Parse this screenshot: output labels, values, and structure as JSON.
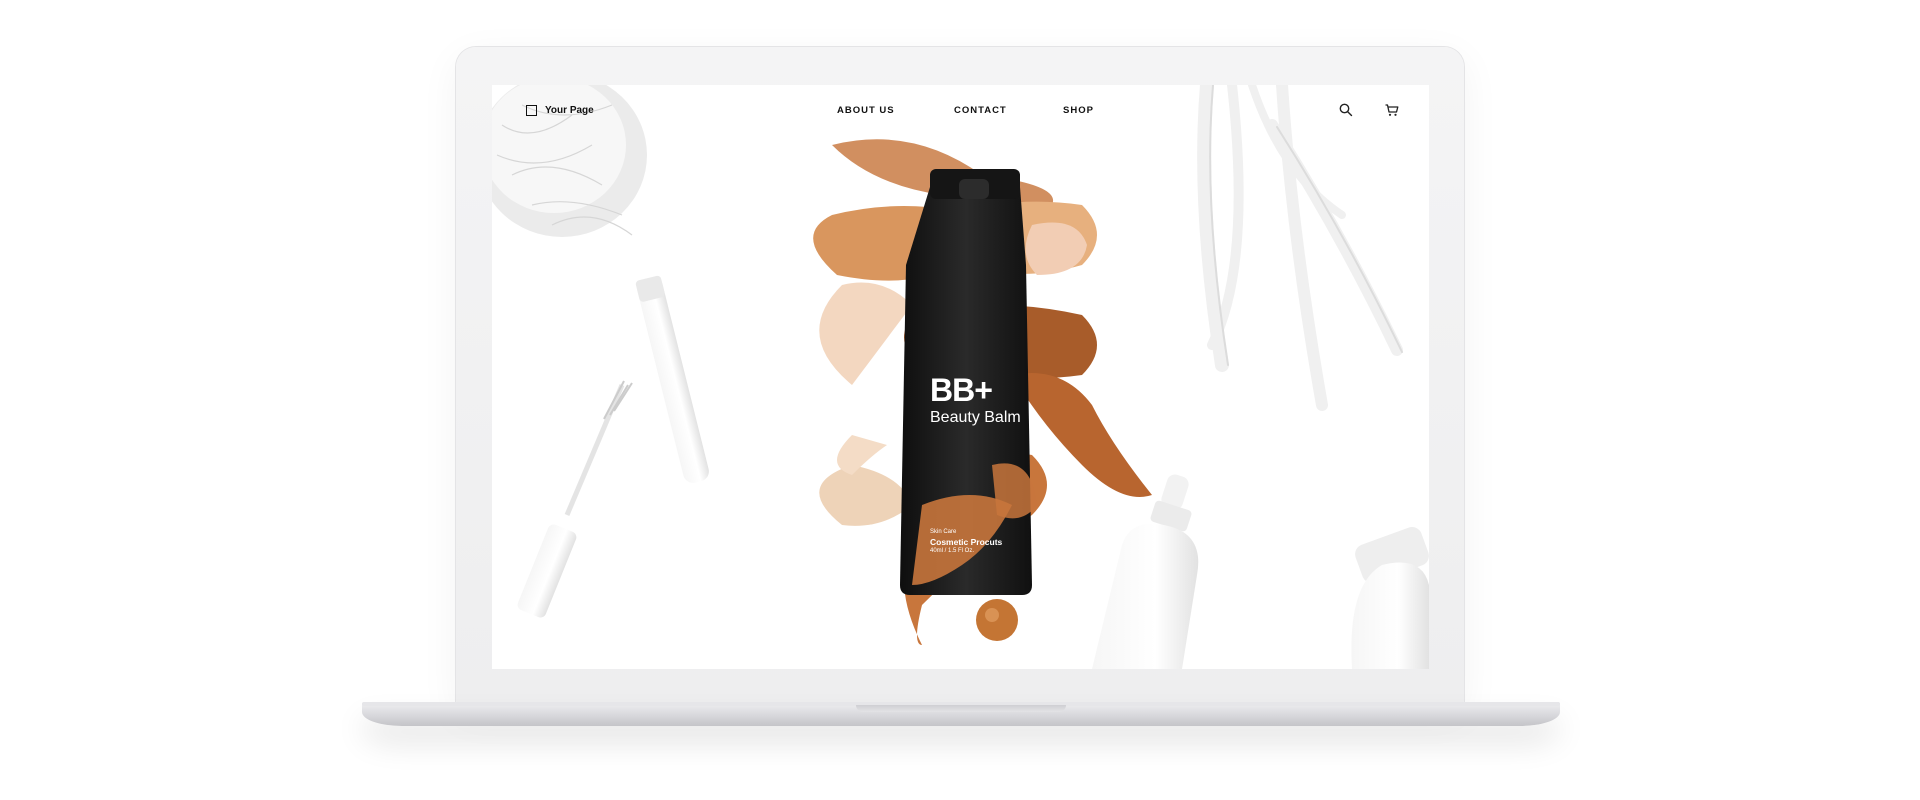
{
  "header": {
    "logo_text": "Your Page",
    "nav": [
      {
        "label": "ABOUT US"
      },
      {
        "label": "CONTACT"
      },
      {
        "label": "SHOP"
      }
    ],
    "icons": [
      "search-icon",
      "cart-icon"
    ]
  },
  "product": {
    "brand_mark": "BB+",
    "name": "Beauty Balm",
    "category": "Skin Care",
    "line": "Cosmetic Procuts",
    "volume": "40ml / 1.5 Fl Oz."
  },
  "colors": {
    "tube": "#1c1c1c",
    "swatch_light": "#f0cdb0",
    "swatch_mid": "#d9965e",
    "swatch_dark": "#b8652f",
    "accent_text": "#111111"
  }
}
